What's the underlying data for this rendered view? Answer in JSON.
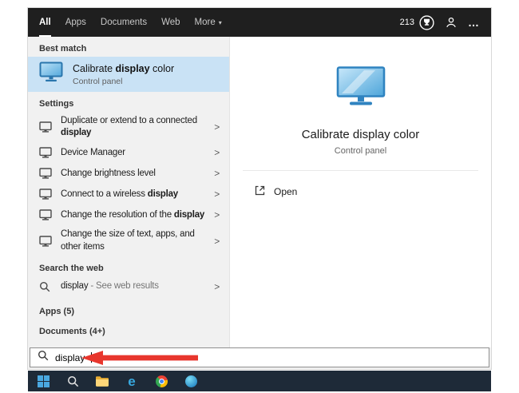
{
  "colors": {
    "topbar_bg": "#1f1f1f",
    "left_panel_bg": "#f1f1f1",
    "highlight_bg": "#c9e2f5",
    "accent_blue": "#2f83c0",
    "arrow_red": "#e8362d",
    "taskbar_bg": "#1e2a38"
  },
  "icons": {
    "chevron_right": ">",
    "dropdown_caret": "▾",
    "more_options": "…"
  },
  "topbar": {
    "tabs": [
      {
        "label": "All",
        "active": true
      },
      {
        "label": "Apps",
        "active": false
      },
      {
        "label": "Documents",
        "active": false
      },
      {
        "label": "Web",
        "active": false
      },
      {
        "label": "More",
        "active": false,
        "has_dropdown": true
      }
    ],
    "rewards_count": "213"
  },
  "left_panel": {
    "best_match": {
      "header": "Best match",
      "title_pre": "Calibrate ",
      "title_bold": "display",
      "title_post": " color",
      "subtitle": "Control panel"
    },
    "settings": {
      "header": "Settings",
      "items": [
        {
          "lines": [
            [
              {
                "t": "Duplicate or extend to a connected"
              }
            ],
            [
              {
                "t": "display",
                "b": true
              }
            ]
          ]
        },
        {
          "lines": [
            [
              {
                "t": "Device Manager"
              }
            ]
          ]
        },
        {
          "lines": [
            [
              {
                "t": "Change brightness level"
              }
            ]
          ]
        },
        {
          "lines": [
            [
              {
                "t": "Connect to a wireless "
              },
              {
                "t": "display",
                "b": true
              }
            ]
          ]
        },
        {
          "lines": [
            [
              {
                "t": "Change the resolution of the "
              },
              {
                "t": "display",
                "b": true
              }
            ]
          ]
        },
        {
          "lines": [
            [
              {
                "t": "Change the size of text, apps, and"
              }
            ],
            [
              {
                "t": "other items"
              }
            ]
          ]
        }
      ]
    },
    "search_web": {
      "header": "Search the web",
      "term": "display",
      "suffix": " - See web results"
    },
    "apps_header": "Apps (5)",
    "documents_header": "Documents (4+)"
  },
  "preview_panel": {
    "title": "Calibrate display color",
    "subtitle": "Control panel",
    "action": "Open"
  },
  "search_box": {
    "value": "display"
  },
  "taskbar": {
    "icons": [
      "start",
      "search",
      "file-explorer",
      "edge",
      "chrome",
      "edge-new"
    ]
  }
}
